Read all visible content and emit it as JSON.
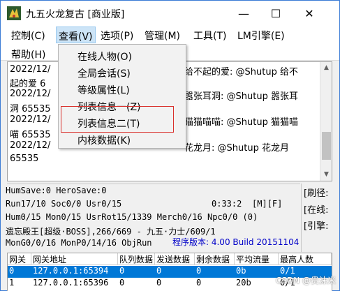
{
  "window": {
    "title": "九五火龙复古 [商业版]",
    "min_glyph": "—",
    "max_glyph": "☐",
    "close_glyph": "✕"
  },
  "menubar": {
    "control": "控制(C)",
    "view": "查看(V)",
    "options": "选项(P)",
    "manage": "管理(M)",
    "tools": "工具(T)",
    "lm": "LM引擎(E)",
    "help": "帮助(H)"
  },
  "view_menu": {
    "items": [
      "在线人物(O)",
      "全局会话(S)",
      "等级属性(L)",
      "列表信息一(Z)",
      "列表信息二(T)",
      "内核数据(K)"
    ]
  },
  "log": {
    "lines": [
      "2022/12/",
      "起的爱 6",
      "2022/12/",
      "洞 65535",
      "2022/12/",
      "喵 65535",
      "2022/12/",
      "65535"
    ],
    "right_fragments": [
      "给不起的爱: @Shutup 给不",
      "嚣张耳洞: @Shutup 嚣张耳",
      "猫猫喵喵: @Shutup 猫猫喵",
      "花龙月: @Shutup 花龙月"
    ]
  },
  "status": {
    "line1": "HumSave:0 HeroSave:0",
    "line2": "Run17/10 Soc0/0 Usr0/15",
    "clock": "0:33:2",
    "mf": "[M][F]",
    "line3": "Hum0/15 Mon0/15 UsrRot15/1339 Merch0/16 Npc0/0 (0)",
    "line4": "遗忘殿王[超级·BOSS],266/669 - 九五·力士/609/1",
    "line5": "MonG0/0/16 MonP0/14/16 ObjRun",
    "version": "程序版本: 4.00 Build 20151104"
  },
  "side": {
    "refresh": "[刷径:",
    "online": "[在线:",
    "engine": "[引擎:"
  },
  "table": {
    "headers": [
      "网关",
      "网关地址",
      "队列数据",
      "发送数据",
      "剩余数据",
      "平均流量",
      "最高人数"
    ],
    "rows": [
      [
        "0",
        "127.0.0.1:65394",
        "0",
        "0",
        "0",
        "0b",
        "0/1"
      ],
      [
        "1",
        "127.0.0.1:65396",
        "0",
        "0",
        "0",
        "20b",
        "0/1"
      ]
    ]
  },
  "watermark": "CSDN @贵沫米",
  "colors": {
    "accent": "#0078d7",
    "highlight_box": "#d9302c",
    "version_text": "#0000c8"
  }
}
